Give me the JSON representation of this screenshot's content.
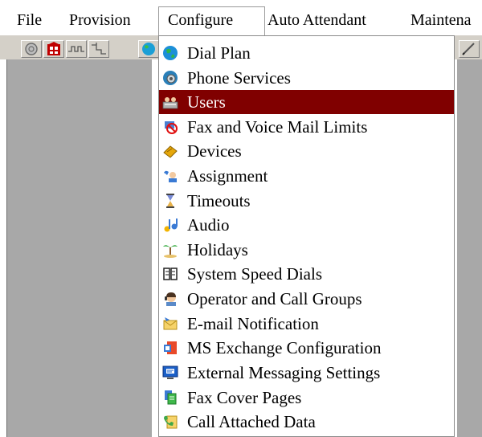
{
  "menubar": {
    "items": [
      "File",
      "Provision",
      "Configure",
      "Auto Attendant",
      "Maintena"
    ]
  },
  "toolbar": {
    "buttons": [
      "phone-icon",
      "building-icon",
      "wave-icon",
      "graph-icon",
      "globe-icon"
    ],
    "right_icon": "pen-icon"
  },
  "dropdown": {
    "items": [
      {
        "label": "Dial Plan",
        "icon": "globe-icon"
      },
      {
        "label": "Phone Services",
        "icon": "gear-globe-icon"
      },
      {
        "label": "Users",
        "icon": "users-icon",
        "selected": true
      },
      {
        "label": "Fax and Voice Mail Limits",
        "icon": "no-fax-icon"
      },
      {
        "label": "Devices",
        "icon": "devices-icon"
      },
      {
        "label": "Assignment",
        "icon": "assignment-icon"
      },
      {
        "label": "Timeouts",
        "icon": "hourglass-icon"
      },
      {
        "label": "Audio",
        "icon": "music-icon"
      },
      {
        "label": "Holidays",
        "icon": "palm-tree-icon"
      },
      {
        "label": "System Speed Dials",
        "icon": "book-icon"
      },
      {
        "label": "Operator and Call Groups",
        "icon": "operator-icon"
      },
      {
        "label": "E-mail Notification",
        "icon": "email-icon"
      },
      {
        "label": "MS Exchange Configuration",
        "icon": "exchange-icon"
      },
      {
        "label": "External Messaging Settings",
        "icon": "monitor-icon"
      },
      {
        "label": "Fax Cover Pages",
        "icon": "fax-pages-icon"
      },
      {
        "label": "Call Attached Data",
        "icon": "call-data-icon"
      }
    ]
  },
  "colors": {
    "selected_bg": "#800000",
    "panel_bg": "#a8a8a8",
    "toolbar_bg": "#d4d0c8"
  }
}
